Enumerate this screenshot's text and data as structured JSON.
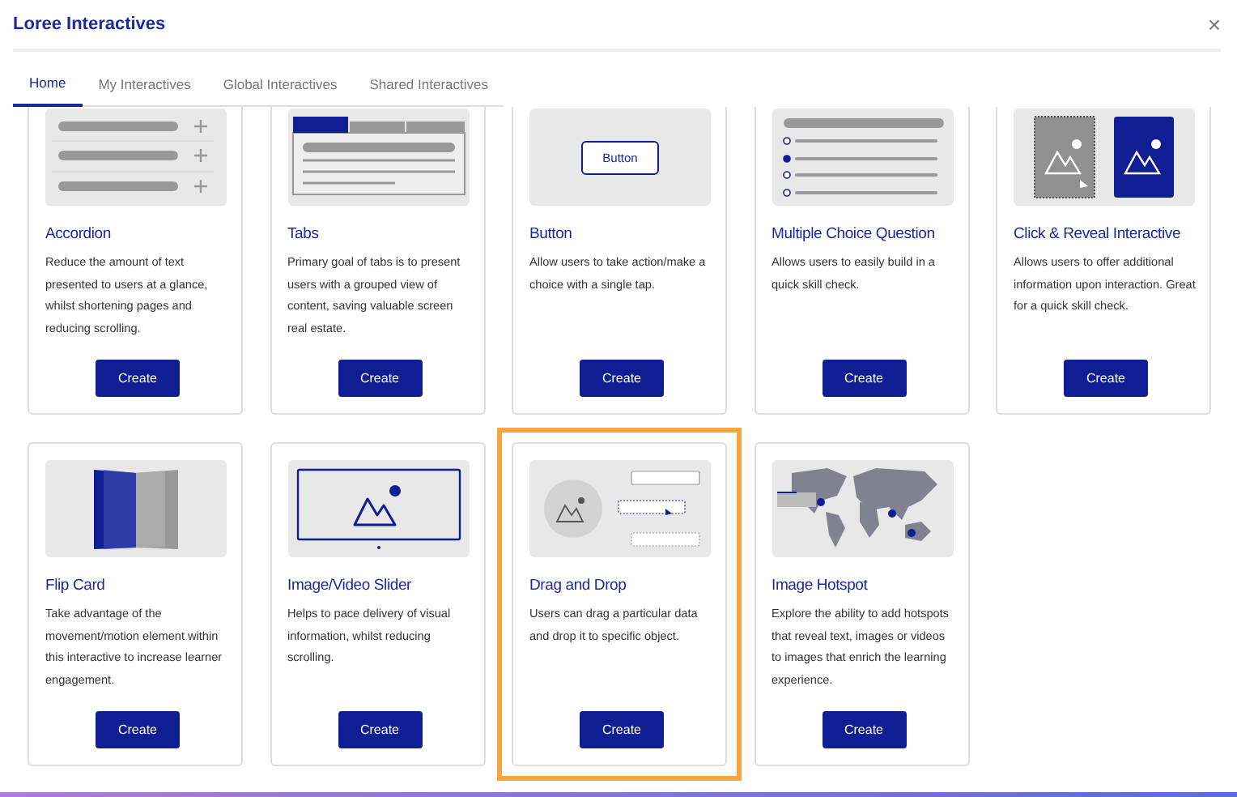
{
  "window": {
    "title": "Loree Interactives",
    "close": "×"
  },
  "tabs": [
    {
      "label": "Home",
      "selected": true
    },
    {
      "label": "My Interactives",
      "selected": false
    },
    {
      "label": "Global Interactives",
      "selected": false
    },
    {
      "label": "Shared Interactives",
      "selected": false
    }
  ],
  "cards": [
    {
      "kind": "accordion",
      "title": "Accordion",
      "description": "Reduce the amount of text presented to users at a glance, whilst shortening pages and reducing scrolling.",
      "button": "Create",
      "selected": false
    },
    {
      "kind": "tabs",
      "title": "Tabs",
      "description": "Primary goal of tabs is to present users with a grouped view of content, saving valuable screen real estate.",
      "button": "Create",
      "selected": false
    },
    {
      "kind": "button",
      "preview_label": "Button",
      "title": "Button",
      "description": "Allow users to take action/make a choice with a single tap.",
      "button": "Create",
      "selected": false
    },
    {
      "kind": "mcq",
      "title": "Multiple Choice Question",
      "description": "Allows users to easily build in a quick skill check.",
      "button": "Create",
      "selected": false
    },
    {
      "kind": "reveal",
      "title": "Click & Reveal Interactive",
      "description": "Allows users to offer additional information upon interaction. Great for a quick skill check.",
      "button": "Create",
      "selected": false
    },
    {
      "kind": "flip",
      "title": "Flip Card",
      "description": "Take advantage of the movement/motion element within this interactive to increase learner engagement.",
      "button": "Create",
      "selected": false
    },
    {
      "kind": "slider",
      "title": "Image/Video Slider",
      "description": "Helps to pace delivery of visual information, whilst reducing scrolling.",
      "button": "Create",
      "selected": false
    },
    {
      "kind": "dragdrop",
      "title": "Drag and Drop",
      "description": "Users can drag a particular data and drop it to specific object.",
      "button": "Create",
      "selected": true
    },
    {
      "kind": "hotspot",
      "title": "Image Hotspot",
      "description": "Explore the ability to add hotspots that reveal text, images or videos to images that enrich the learning experience.",
      "button": "Create",
      "selected": false
    }
  ]
}
